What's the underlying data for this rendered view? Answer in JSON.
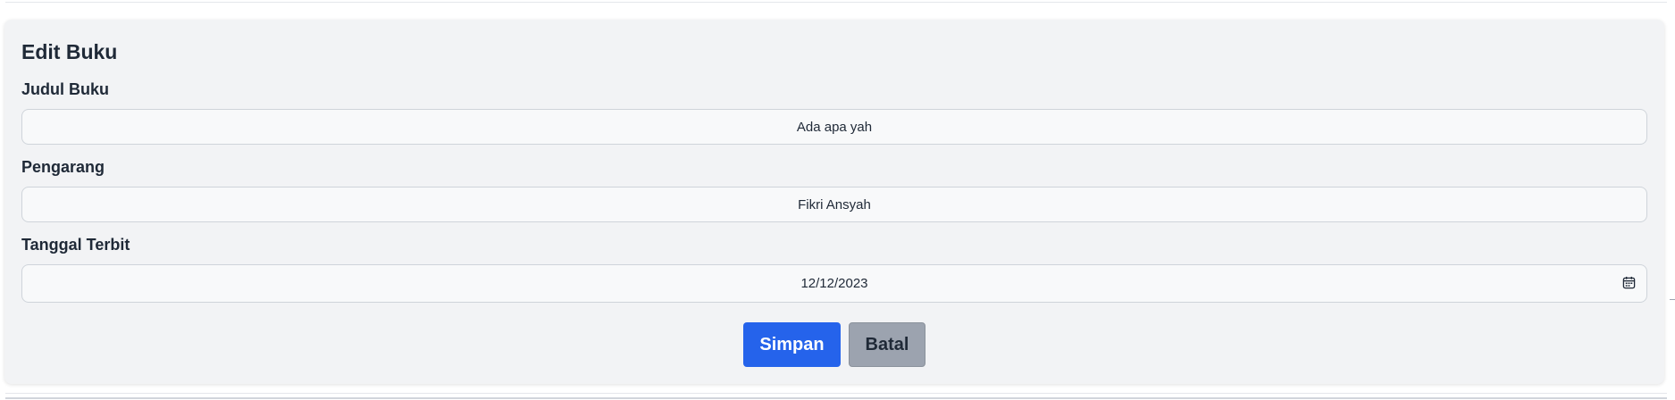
{
  "form": {
    "title": "Edit Buku",
    "fields": [
      {
        "label": "Judul Buku",
        "value": "Ada apa yah"
      },
      {
        "label": "Pengarang",
        "value": "Fikri Ansyah"
      },
      {
        "label": "Tanggal Terbit",
        "value": "12/12/2023",
        "icon": "calendar-icon"
      }
    ],
    "buttons": {
      "save_label": "Simpan",
      "cancel_label": "Batal"
    }
  },
  "colors": {
    "card_background": "#f2f3f5",
    "save_button": "#2563eb",
    "cancel_button": "#9ca3af"
  }
}
